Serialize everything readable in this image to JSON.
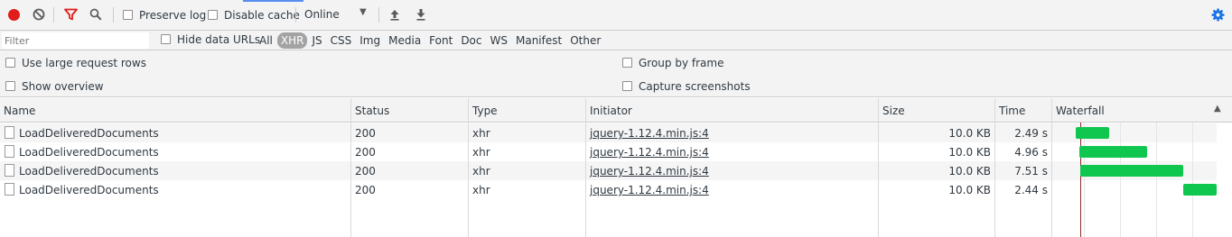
{
  "colors": {
    "accent_blue": "#5a8df0",
    "record_red": "#e21b1b",
    "filter_red": "#e21b1b",
    "bar_green": "#0fc64f",
    "load_line": "#8b2a2a",
    "active_type_bg": "#a3a3a3"
  },
  "toolbar": {
    "record_icon": "record-icon",
    "clear_icon": "clear-icon",
    "filter_icon": "filter-icon",
    "search_icon": "search-icon",
    "preserve_log_label": "Preserve log",
    "disable_cache_label": "Disable cache",
    "throttling_value": "Online",
    "upload_icon": "import-har-icon",
    "download_icon": "export-har-icon",
    "settings_icon": "gear-icon"
  },
  "filterbar": {
    "filter_placeholder": "Filter",
    "hide_data_urls_label": "Hide data URLs",
    "types": [
      "All",
      "XHR",
      "JS",
      "CSS",
      "Img",
      "Media",
      "Font",
      "Doc",
      "WS",
      "Manifest",
      "Other"
    ],
    "active_type": "XHR"
  },
  "options": {
    "large_rows_label": "Use large request rows",
    "show_overview_label": "Show overview",
    "group_by_frame_label": "Group by frame",
    "capture_screenshots_label": "Capture screenshots"
  },
  "table": {
    "headers": {
      "name": "Name",
      "status": "Status",
      "type": "Type",
      "initiator": "Initiator",
      "size": "Size",
      "time": "Time",
      "waterfall": "Waterfall"
    },
    "rows": [
      {
        "name": "LoadDeliveredDocuments",
        "status": "200",
        "type": "xhr",
        "initiator": "jquery-1.12.4.min.js:4",
        "size": "10.0 KB",
        "time": "2.49 s"
      },
      {
        "name": "LoadDeliveredDocuments",
        "status": "200",
        "type": "xhr",
        "initiator": "jquery-1.12.4.min.js:4",
        "size": "10.0 KB",
        "time": "4.96 s"
      },
      {
        "name": "LoadDeliveredDocuments",
        "status": "200",
        "type": "xhr",
        "initiator": "jquery-1.12.4.min.js:4",
        "size": "10.0 KB",
        "time": "7.51 s"
      },
      {
        "name": "LoadDeliveredDocuments",
        "status": "200",
        "type": "xhr",
        "initiator": "jquery-1.12.4.min.js:4",
        "size": "10.0 KB",
        "time": "2.44 s"
      }
    ]
  }
}
